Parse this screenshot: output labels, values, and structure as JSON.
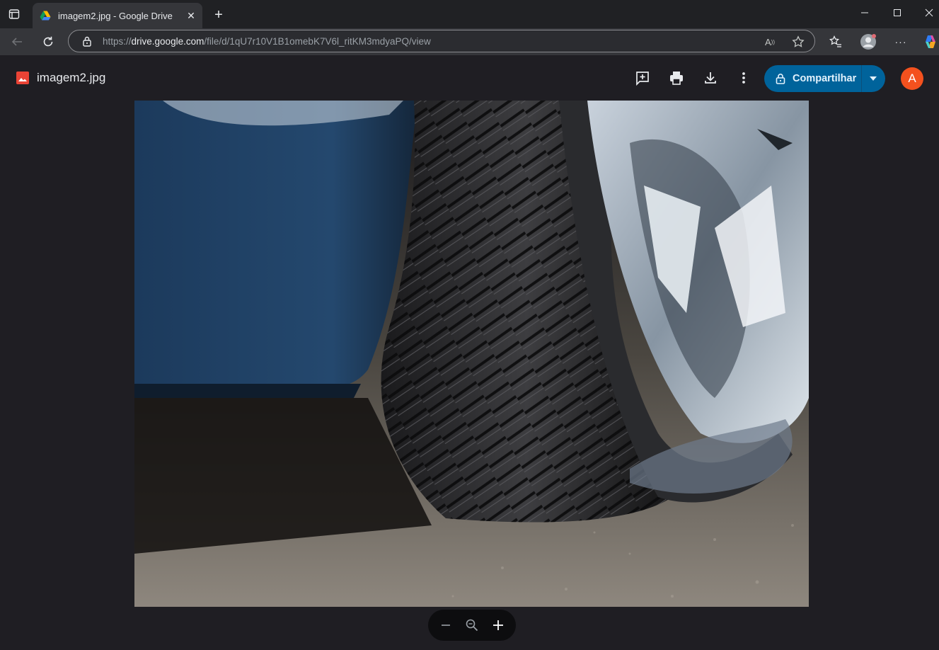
{
  "browser": {
    "tab_title": "imagem2.jpg - Google Drive",
    "close_glyph": "✕",
    "newtab_glyph": "+",
    "url_prefix": "https://",
    "url_domain": "drive.google.com",
    "url_path": "/file/d/1qU7r10V1B1omebK7V6l_ritKM3mdyaPQ/view",
    "read_aloud_glyph": "A",
    "more_glyph": "···"
  },
  "viewer": {
    "file_name": "imagem2.jpg",
    "share_label": "Compartilhar",
    "avatar_letter": "A",
    "accent_color": "#00639b",
    "avatar_color": "#f4511e"
  },
  "icons": {
    "file_type": "image-file-icon",
    "add_comment": "add-comment-icon",
    "print": "print-icon",
    "download": "download-icon",
    "more": "more-vert-icon",
    "zoom_out": "minus-icon",
    "zoom_reset": "zoom-icon",
    "zoom_in": "plus-icon"
  }
}
